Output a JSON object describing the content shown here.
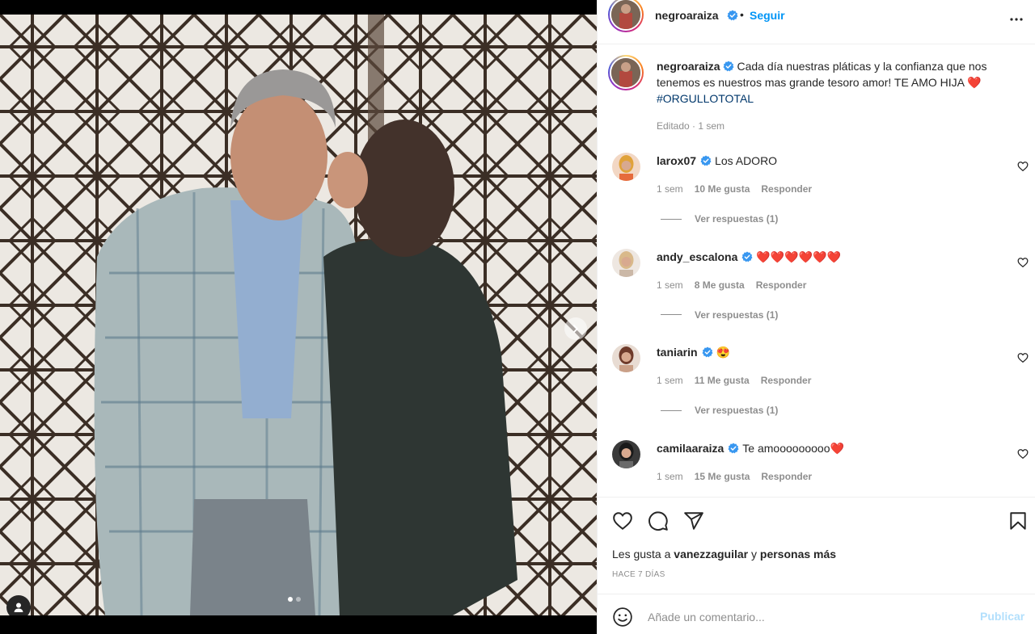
{
  "post": {
    "author": "negroaraiza",
    "follow_label": "Seguir",
    "separator": "•",
    "caption": "Cada día nuestras pláticas y la confianza que nos tenemos es nuestros mas grande tesoro amor! TE AMO HIJA ❤️",
    "hashtag": "#ORGULLOTOTAL",
    "caption_meta": "Editado · 1 sem"
  },
  "media": {
    "carousel_total": 2,
    "carousel_active": 1
  },
  "comments": [
    {
      "user": "larox07",
      "text": "Los ADORO",
      "age": "1 sem",
      "likes": "10 Me gusta",
      "reply": "Responder",
      "replies": "Ver respuestas (1)"
    },
    {
      "user": "andy_escalona",
      "text": "❤️❤️❤️❤️❤️❤️",
      "age": "1 sem",
      "likes": "8 Me gusta",
      "reply": "Responder",
      "replies": "Ver respuestas (1)"
    },
    {
      "user": "taniarin",
      "text": "😍",
      "age": "1 sem",
      "likes": "11 Me gusta",
      "reply": "Responder",
      "replies": "Ver respuestas (1)"
    },
    {
      "user": "camilaaraiza",
      "text": "Te amooooooooo❤️",
      "age": "1 sem",
      "likes": "15 Me gusta",
      "reply": "Responder"
    }
  ],
  "likes_line": {
    "prefix": "Les gusta a",
    "user": "vanezzaguilar",
    "conj": "y",
    "others": "personas más"
  },
  "timestamp": "HACE 7 DÍAS",
  "add_comment": {
    "placeholder": "Añade un comentario...",
    "publish_label": "Publicar"
  },
  "colors": {
    "accent": "#0095f6",
    "hashtag": "#00376b",
    "publish_disabled": "#b2dffc",
    "verified": "#3897f0"
  },
  "icons": [
    "user-tag-icon",
    "chevron-right-icon",
    "verified-icon",
    "more-icon",
    "heart-icon",
    "comment-icon",
    "share-icon",
    "bookmark-icon",
    "emoji-icon"
  ]
}
